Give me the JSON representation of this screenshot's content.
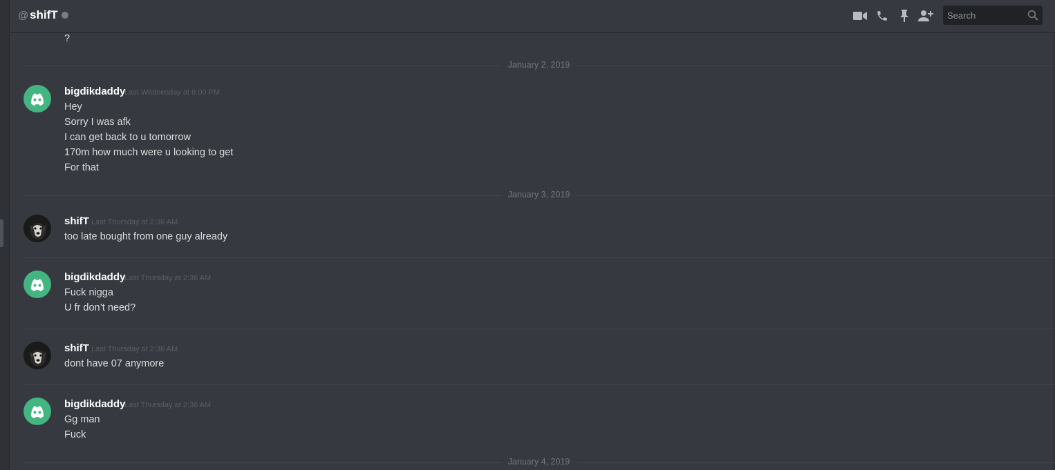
{
  "header": {
    "at_symbol": "@",
    "title": "shifT",
    "search_placeholder": "Search",
    "icons": [
      "video-call-icon",
      "voice-call-icon",
      "pin-icon",
      "add-friend-icon",
      "search-icon"
    ]
  },
  "colors": {
    "background": "#36393f",
    "header_text": "#ffffff",
    "message_text": "#dcddde",
    "timestamp": "#72767d",
    "discord_green": "#43b581",
    "status_offline": "#747f8d",
    "search_bg": "#202225"
  },
  "messages": {
    "orphan_line": "?",
    "dividers": [
      "January 2, 2019",
      "January 3, 2019",
      "January 4, 2019"
    ],
    "groups": [
      {
        "author": "bigdikdaddy",
        "avatar": "discord-logo-avatar",
        "timestamp": "Last Wednesday at 6:00 PM",
        "lines": [
          "Hey",
          "Sorry I was afk",
          "I can get back to u tomorrow",
          "170m how much were u looking to get",
          "For that"
        ]
      },
      {
        "author": "shifT",
        "avatar": "dog-photo-avatar",
        "timestamp": "Last Thursday at 2:36 AM",
        "lines": [
          "too late bought from one guy already"
        ]
      },
      {
        "author": "bigdikdaddy",
        "avatar": "discord-logo-avatar",
        "timestamp": "Last Thursday at 2:36 AM",
        "lines": [
          "Fuck nigga",
          "U fr don’t need?"
        ]
      },
      {
        "author": "shifT",
        "avatar": "dog-photo-avatar",
        "timestamp": "Last Thursday at 2:36 AM",
        "lines": [
          "dont have 07 anymore"
        ]
      },
      {
        "author": "bigdikdaddy",
        "avatar": "discord-logo-avatar",
        "timestamp": "Last Thursday at 2:36 AM",
        "lines": [
          "Gg man",
          "Fuck"
        ]
      }
    ]
  }
}
